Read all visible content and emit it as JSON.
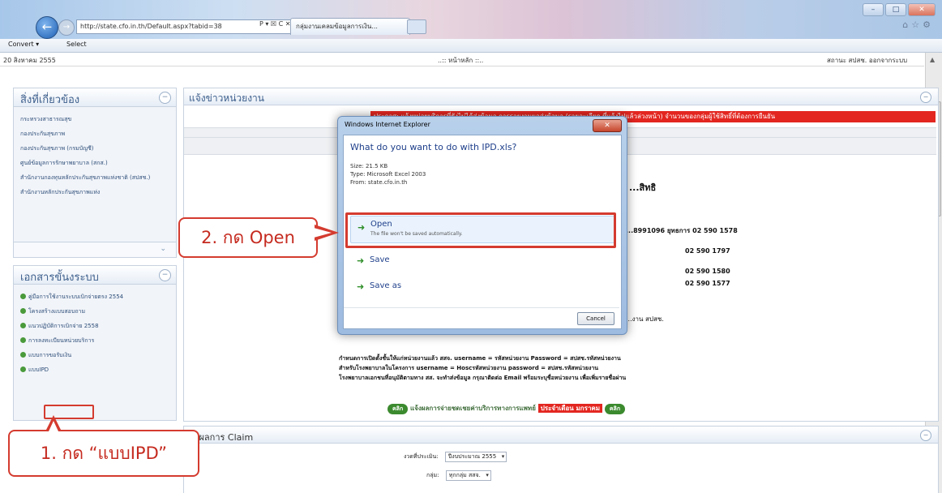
{
  "browser": {
    "address": "http://state.cfo.in.th/Default.aspx?tabid=38",
    "address_controls": "P ▾ ☒ C ✕",
    "tab_label": "กลุ่มงานเคลมข้อมูลการเงิน...",
    "toolbar": {
      "convert": "Convert ▾",
      "select": "Select"
    }
  },
  "page": {
    "date": "20 สิงหาคม 2555",
    "center_title": "..:: หน้าหลัก ::..",
    "right_links": "สถานะ สปสช.  ออกจากระบบ"
  },
  "left_panel_1": {
    "title": "สิ่งที่เกี่ยวข้อง",
    "items": [
      "กระทรวงสาธารณสุข",
      "กองประกันสุขภาพ",
      "กองประกันสุขภาพ (กรมบัญชี)",
      "ศูนย์ข้อมูลการรักษาพยาบาล (สกส.)",
      "สำนักงานกองทุนหลักประกันสุขภาพแห่งชาติ (สปสช.)",
      "สำนักงานหลักประกันสุขภาพแห่ง"
    ]
  },
  "left_panel_2": {
    "title": "เอกสารขั้นงระบบ",
    "items": [
      "คู่มือการใช้งานระบบเบิกจ่ายตรง 2554",
      "โครงสร้างแบบสอบถาม",
      "แนวปฏิบัติการเบิกจ่าย 2558",
      "การลงทะเบียนหน่วยบริการ",
      "แบบการขอรับเงิน",
      "แบบIPD"
    ]
  },
  "news": {
    "title": "แจ้งข่าวหน่วยงาน",
    "ticker": "ประกาศ: แจ้งหน่วยบริการที่ยังไม่ได้ส่งข้อมูล การรายงานผลส่งข้อมูล (รายละเอียด ที่แจ้งไปแล้วล่วงหน้า) จำนวนของกลุ่มผู้ใช้สิทธิ์ที่ต้องการยืนยัน",
    "org": "...สิทธิ",
    "contacts": [
      "...8991096 ยุทธการ 02 590 1578",
      "02 590 1797",
      "02 590 1580",
      "02 590 1577"
    ],
    "contact_note": "...งาน สปสช.",
    "body_lines": [
      "กำหนดการเปิดตั้งชั้นให้แก่หน่วยงานแล้ว  สสจ. username =  รหัสหน่วยงาน      Password = สปสช.รหัสหน่วยงาน",
      "สำหรับโรงพยาบาลในโครงการ                      username =  Hoscรหัสหน่วยงาน    password = สปสช.รหัสหน่วยงาน",
      "โรงพยาบาลเอกชนที่อนุมัติตามทาง สส. จะทำส่งข้อมูล กรุณาติดต่อ Email พร้อมระบุชื่อหน่วยงาน เพื่อเพิ่มรายชื่อผ่าน"
    ],
    "promo_prefix": "แจ้งผลการจ่ายชดเชยค่าบริการทางการแพทย์",
    "promo_highlight": "ประจำเดือน มกราคม",
    "promo_arrow_left": "คลิก",
    "promo_arrow_right": "คลิก"
  },
  "claim": {
    "title": "...ผลการ Claim",
    "row1_label": "งวดที่ประเมิน:",
    "row1_value": "ปีงบประมาณ 2555",
    "row2_label": "กลุ่ม:",
    "row2_value": "ทุกกลุ่ม สสจ."
  },
  "dialog": {
    "window_title": "Windows Internet Explorer",
    "close": "✕",
    "question": "What do you want to do with IPD.xls?",
    "size": "Size: 21.5 KB",
    "type": "Type: Microsoft Excel 2003",
    "from": "From: state.cfo.in.th",
    "options": [
      {
        "label": "Open",
        "sub": "The file won't be saved automatically."
      },
      {
        "label": "Save",
        "sub": ""
      },
      {
        "label": "Save as",
        "sub": ""
      }
    ],
    "cancel": "Cancel"
  },
  "callouts": {
    "step2": "2. กด Open",
    "step1": "1. กด “แบบIPD”"
  },
  "colors": {
    "highlight_red": "#d43b2f",
    "ticker_red": "#e32620",
    "link_blue": "#2e4e79"
  }
}
